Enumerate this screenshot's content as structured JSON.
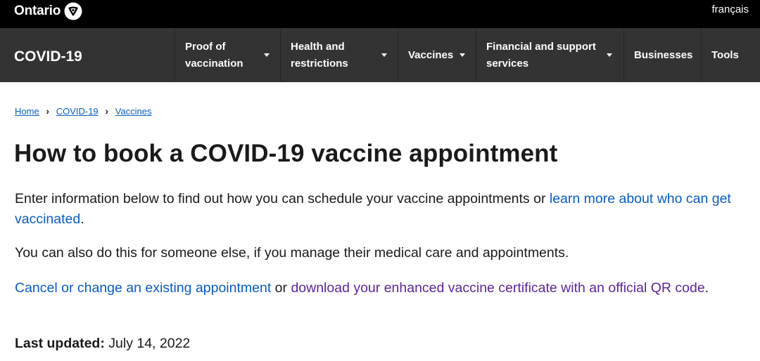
{
  "topbar": {
    "logo_text": "Ontario",
    "logo_icon": "ontario-trillium-icon",
    "language_link": "français"
  },
  "navbar": {
    "brand": "COVID-19",
    "items": [
      {
        "line1": "Proof of",
        "line2": "vaccination",
        "has_dropdown": true
      },
      {
        "line1": "Health and",
        "line2": "restrictions",
        "has_dropdown": true
      },
      {
        "line1": "Vaccines",
        "line2": "",
        "has_dropdown": true
      },
      {
        "line1": "Financial and support",
        "line2": "services",
        "has_dropdown": true
      },
      {
        "line1": "Businesses",
        "line2": "",
        "has_dropdown": false
      },
      {
        "line1": "Tools",
        "line2": "",
        "has_dropdown": false
      }
    ]
  },
  "breadcrumb": {
    "items": [
      "Home",
      "COVID-19",
      "Vaccines"
    ],
    "separator": "›"
  },
  "main": {
    "title": "How to book a COVID-19 vaccine appointment",
    "intro_text": "Enter information below to find out how you can schedule your vaccine appointments or ",
    "intro_link": "learn more about who can get vaccinated",
    "intro_end": ".",
    "someone_else_text": "You can also do this for someone else, if you manage their medical care and appointments.",
    "cancel_link": "Cancel or change an existing appointment",
    "or_text": " or ",
    "certificate_link": "download your enhanced vaccine certificate with an official QR code",
    "certificate_end": ".",
    "last_updated_label": "Last updated:",
    "last_updated_value": " July 14, 2022"
  },
  "colors": {
    "topbar_bg": "#000000",
    "navbar_bg": "#333333",
    "link": "#0a5cc2",
    "visited_link": "#5c2699",
    "text": "#1a1a1a"
  }
}
